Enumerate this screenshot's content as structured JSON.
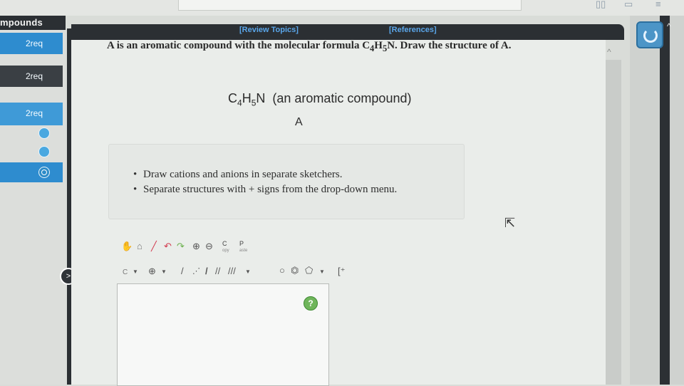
{
  "sidebar": {
    "title": "mpounds",
    "items": [
      {
        "label": "2req"
      },
      {
        "label": "2req"
      },
      {
        "label": "2req"
      }
    ]
  },
  "header": {
    "review_link": "[Review Topics]",
    "references_link": "[References]"
  },
  "question": {
    "text_start": "A is an aromatic compound with the molecular formula C",
    "sub1": "4",
    "text_mid1": "H",
    "sub2": "5",
    "text_end": "N. Draw the structure of A."
  },
  "formula": {
    "part_c": "C",
    "sub_c": "4",
    "part_h": "H",
    "sub_h": "5",
    "part_rest": "N  (an aromatic compound)"
  },
  "compound_label": "A",
  "instructions": [
    "Draw cations and anions in separate sketchers.",
    "Separate structures with + signs from the drop-down menu."
  ],
  "toolbar": {
    "copy_label": "C",
    "copy_sub": "opy",
    "paste_label": "P",
    "paste_sub": "aste",
    "element_label": "C",
    "help_label": "?"
  },
  "colors": {
    "sidebar_active": "#2e8ccf",
    "sidebar_active_light": "#3f9ad7",
    "link": "#5aa6ea",
    "help": "#6fb55b"
  }
}
